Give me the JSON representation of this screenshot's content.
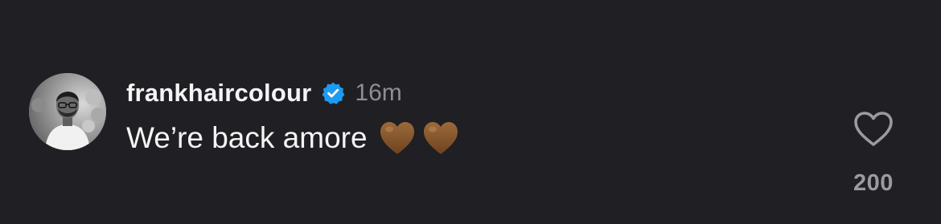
{
  "comment": {
    "username": "frankhaircolour",
    "verified": true,
    "timestamp": "16m",
    "text": "We’re back amore",
    "emoji": [
      "brown-heart",
      "brown-heart"
    ],
    "like_count": "200"
  },
  "colors": {
    "background": "#1f1f24",
    "primary_text": "#f4f4f5",
    "secondary_text": "#8e8e93",
    "verified_badge": "#1d9bf0",
    "brown_heart": "#8b5a2b",
    "like_icon": "#9a9aa0"
  },
  "icons": {
    "avatar": "profile-photo",
    "verified": "verified-badge-icon",
    "like": "heart-outline-icon"
  }
}
